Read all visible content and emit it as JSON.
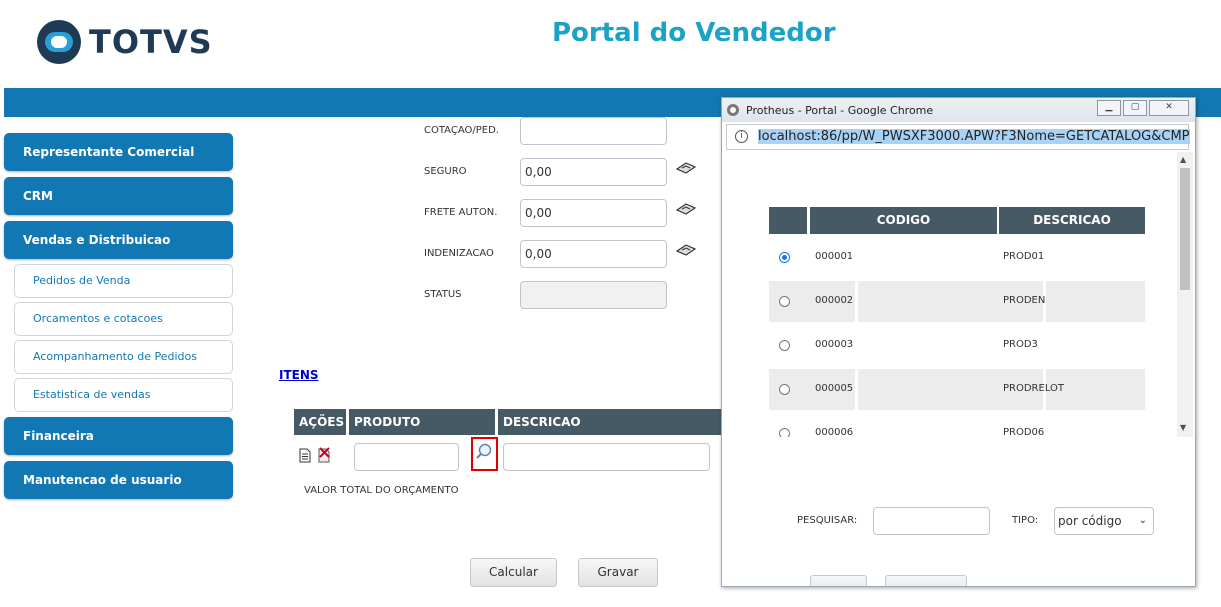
{
  "header": {
    "logo_text": "TOTVS",
    "title": "Portal do Vendedor"
  },
  "sidebar": {
    "main_items": [
      {
        "label": "Representante Comercial"
      },
      {
        "label": "CRM"
      },
      {
        "label": "Vendas e Distribuicao"
      },
      {
        "label": "Financeira"
      },
      {
        "label": "Manutencao de usuario"
      }
    ],
    "sub_items": [
      {
        "label": "Pedidos de Venda"
      },
      {
        "label": "Orcamentos e cotacoes"
      },
      {
        "label": "Acompanhamento de Pedidos"
      },
      {
        "label": "Estatistica de vendas"
      }
    ]
  },
  "form": {
    "fields": [
      {
        "label": "COTAÇAO/PED.",
        "value": ""
      },
      {
        "label": "SEGURO",
        "value": "0,00"
      },
      {
        "label": "FRETE AUTON.",
        "value": "0,00"
      },
      {
        "label": "INDENIZACAO",
        "value": "0,00"
      },
      {
        "label": "STATUS",
        "value": ""
      }
    ]
  },
  "items": {
    "link": "ITENS",
    "columns": [
      "AÇÕES",
      "PRODUTO",
      "DESCRICAO"
    ],
    "total_label": "VALOR TOTAL DO ORÇAMENTO"
  },
  "buttons": {
    "calcular": "Calcular",
    "gravar": "Gravar"
  },
  "popup": {
    "window_title": "Protheus - Portal - Google Chrome",
    "url": "localhost:86/pp/W_PWSXF3000.APW?F3Nome=GETCATALOG&CMP",
    "columns": [
      "CODIGO",
      "DESCRICAO"
    ],
    "rows": [
      {
        "codigo": "000001",
        "descricao": "PROD01",
        "selected": true
      },
      {
        "codigo": "000002",
        "descricao": "PRODEN",
        "selected": false
      },
      {
        "codigo": "000003",
        "descricao": "PROD3",
        "selected": false
      },
      {
        "codigo": "000005",
        "descricao": "PRODRELOT",
        "selected": false
      },
      {
        "codigo": "000006",
        "descricao": "PROD06",
        "selected": false
      }
    ],
    "search_label": "PESQUISAR:",
    "search_value": "",
    "type_label": "TIPO:",
    "type_value": "por código"
  },
  "icons": {
    "calc": "calculator-icon",
    "search": "magnifier-icon",
    "edit": "document-icon",
    "delete": "delete-icon"
  }
}
